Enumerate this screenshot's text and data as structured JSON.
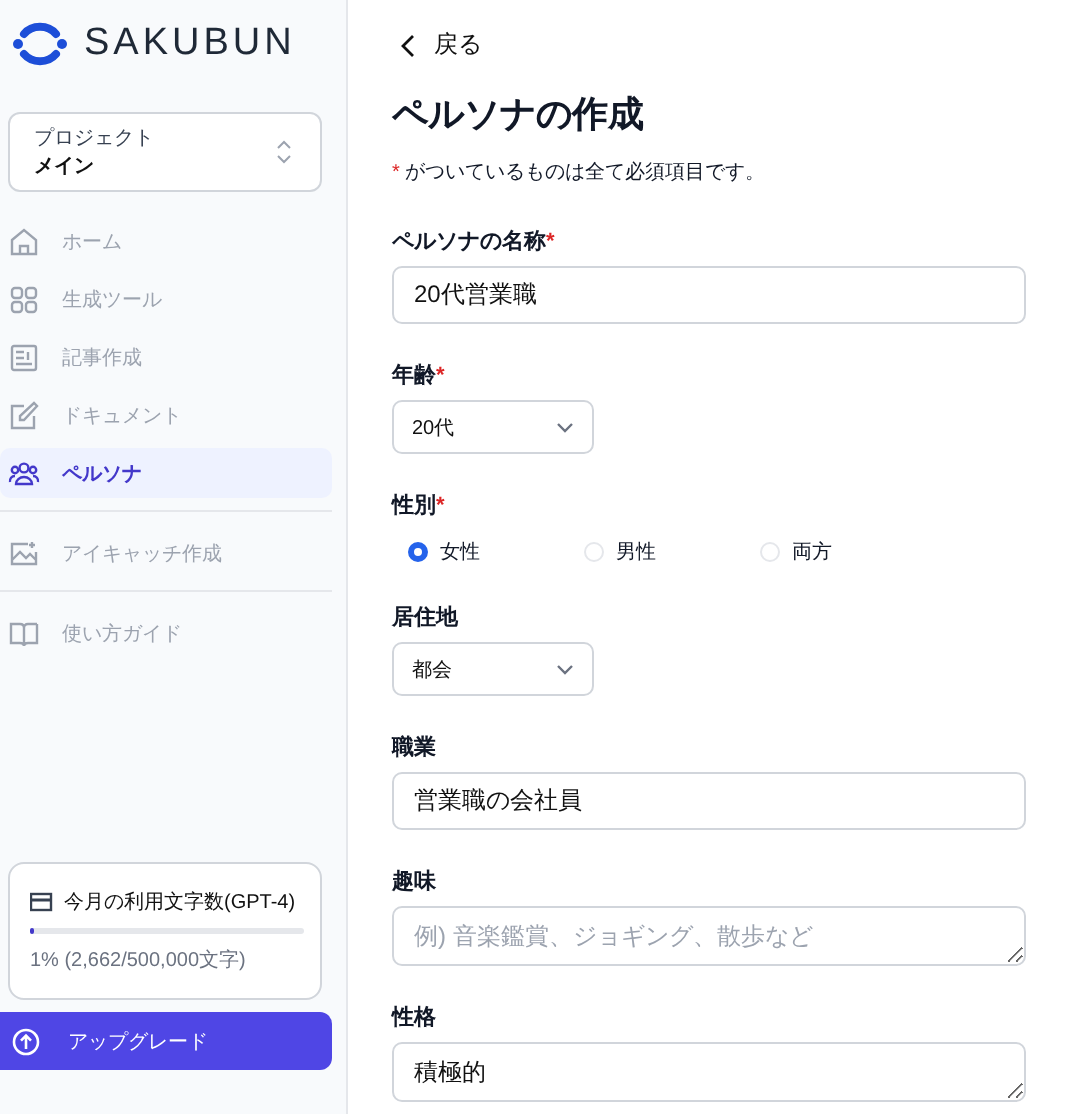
{
  "brand": {
    "name": "SAKUBUN"
  },
  "project": {
    "label": "プロジェクト",
    "value": "メイン"
  },
  "nav_groups": [
    {
      "items": [
        {
          "label": "ホーム",
          "selected": false
        },
        {
          "label": "生成ツール",
          "selected": false
        },
        {
          "label": "記事作成",
          "selected": false
        },
        {
          "label": "ドキュメント",
          "selected": false
        },
        {
          "label": "ペルソナ",
          "selected": true
        }
      ]
    },
    {
      "items": [
        {
          "label": "アイキャッチ作成",
          "selected": false
        }
      ]
    },
    {
      "items": [
        {
          "label": "使い方ガイド",
          "selected": false
        }
      ]
    }
  ],
  "usage": {
    "title": "今月の利用文字数(GPT-4)",
    "level": 0.01,
    "reading": "1% (2,662/500,000文字)"
  },
  "upgrade_button": "アップグレード",
  "back_link": "戻る",
  "page_title": "ペルソナの作成",
  "required_note": {
    "mark": "*",
    "text": "がついているものは全て必須項目です。"
  },
  "fields": [
    {
      "kind": "text",
      "label": "ペルソナの名称",
      "required": true,
      "value": "20代営業職"
    },
    {
      "kind": "select",
      "label": "年齢",
      "required": true,
      "value": "20代"
    },
    {
      "kind": "radio",
      "label": "性別",
      "required": true,
      "options": [
        {
          "label": "女性",
          "selected": true
        },
        {
          "label": "男性",
          "selected": false
        },
        {
          "label": "両方",
          "selected": false
        }
      ]
    },
    {
      "kind": "select",
      "label": "居住地",
      "required": false,
      "value": "都会"
    },
    {
      "kind": "text",
      "label": "職業",
      "required": false,
      "value": "営業職の会社員"
    },
    {
      "kind": "textarea",
      "label": "趣味",
      "required": false,
      "placeholder": "例) 音楽鑑賞、ジョギング、散歩など"
    },
    {
      "kind": "textarea",
      "label": "性格",
      "required": false,
      "value": "積極的"
    }
  ]
}
